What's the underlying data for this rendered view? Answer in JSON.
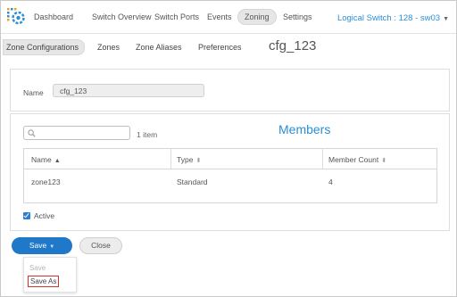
{
  "topnav": {
    "items": [
      {
        "label": "Dashboard",
        "active": false
      },
      {
        "label": "Switch Overview",
        "active": false
      },
      {
        "label": "Switch Ports",
        "active": false
      },
      {
        "label": "Events",
        "active": false
      },
      {
        "label": "Zoning",
        "active": true
      },
      {
        "label": "Settings",
        "active": false
      }
    ],
    "switch_selector": "Logical Switch : 128 - sw03"
  },
  "subnav": {
    "items": [
      {
        "label": "Zone Configurations",
        "active": true
      },
      {
        "label": "Zones",
        "active": false
      },
      {
        "label": "Zone Aliases",
        "active": false
      },
      {
        "label": "Preferences",
        "active": false
      }
    ],
    "config_title": "cfg_123"
  },
  "name_panel": {
    "label": "Name",
    "value": "cfg_123"
  },
  "members": {
    "title": "Members",
    "search_placeholder": "",
    "item_count": "1 item",
    "columns": [
      "Name",
      "Type",
      "Member Count"
    ],
    "rows": [
      {
        "name": "zone123",
        "type": "Standard",
        "member_count": "4"
      }
    ],
    "active_label": "Active",
    "active_checked": true
  },
  "actions": {
    "save_label": "Save",
    "close_label": "Close",
    "dropdown": [
      "Save",
      "Save As"
    ]
  },
  "colors": {
    "accent": "#2a8fd6",
    "save_button": "#1f78c8",
    "highlight": "#d9302a"
  }
}
